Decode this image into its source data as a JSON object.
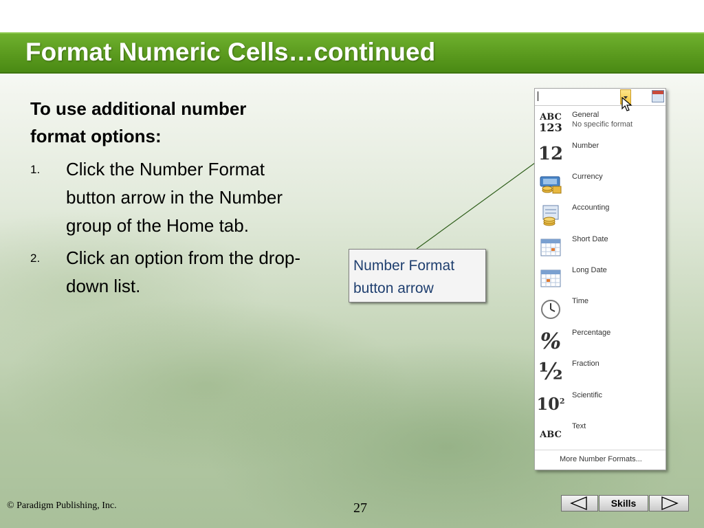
{
  "slide": {
    "title": "Format Numeric Cells…continued",
    "heading": "To use additional number format options:",
    "steps": [
      {
        "number": "1.",
        "text": "Click the Number Format button arrow in the Number group of the Home tab."
      },
      {
        "number": "2.",
        "text": "Click an option from the drop-down list."
      }
    ],
    "callout": "Number Format\nbutton arrow"
  },
  "dropdown": {
    "items": [
      {
        "label": "General",
        "description": "No specific format",
        "icon": "abc-123-icon"
      },
      {
        "label": "Number",
        "icon": "number-12-icon"
      },
      {
        "label": "Currency",
        "icon": "currency-icon"
      },
      {
        "label": "Accounting",
        "icon": "accounting-icon"
      },
      {
        "label": "Short Date",
        "icon": "calendar-icon"
      },
      {
        "label": "Long Date",
        "icon": "calendar-icon"
      },
      {
        "label": "Time",
        "icon": "clock-icon"
      },
      {
        "label": "Percentage",
        "icon": "percent-icon"
      },
      {
        "label": "Fraction",
        "icon": "fraction-icon"
      },
      {
        "label": "Scientific",
        "icon": "scientific-icon"
      },
      {
        "label": "Text",
        "icon": "abc-text-icon"
      }
    ],
    "more_label": "More Number Formats..."
  },
  "icon_glyphs": {
    "abc": "ABC",
    "digits_123": "123",
    "twelve": "12",
    "percent": "%",
    "half": "½",
    "ten": "10",
    "superscript_two": "2",
    "text_abc": "ABC"
  },
  "footer": {
    "copyright": "© Paradigm Publishing, Inc.",
    "page_number": "27",
    "skills_label": "Skills"
  },
  "colors": {
    "title_bar": "#5a9a1e",
    "callout_text": "#1f3f6f"
  }
}
